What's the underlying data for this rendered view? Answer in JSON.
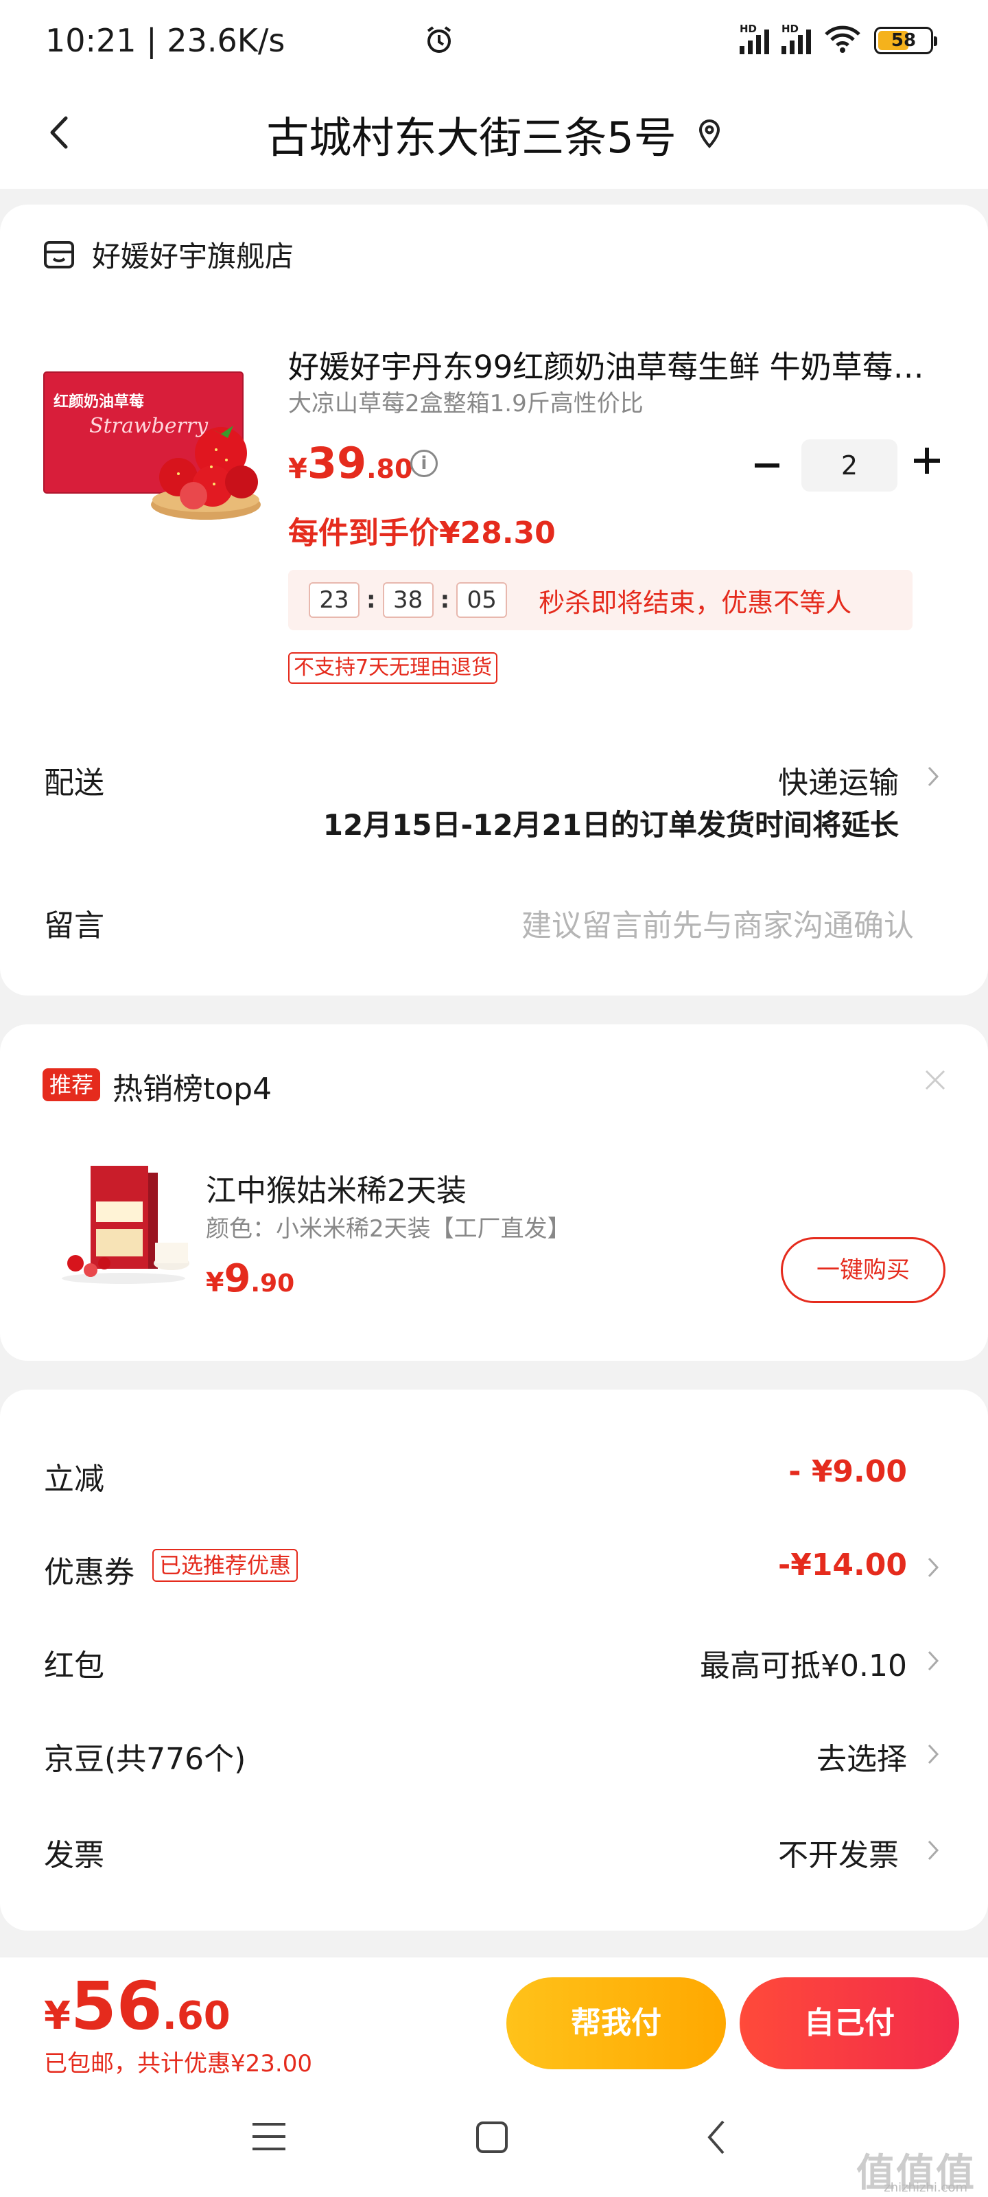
{
  "status_bar": {
    "time": "10:21 | 23.6K/s",
    "signal1": "HD",
    "signal2": "HD",
    "battery": "58"
  },
  "header": {
    "title": "古城村东大街三条5号"
  },
  "store": {
    "name": "好媛好宇旗舰店"
  },
  "product": {
    "name": "好媛好宇丹东99红颜奶油草莓生鲜 牛奶草莓…",
    "spec": "大凉山草莓2盒整箱1.9斤高性价比",
    "price_symbol": "¥",
    "price_int": "39",
    "price_dec": ".80",
    "quantity": "2",
    "final_price": "每件到手价¥28.30",
    "countdown": {
      "h": "23",
      "m": "38",
      "s": "05",
      "text": "秒杀即将结束，优惠不等人"
    },
    "return_tag": "不支持7天无理由退货",
    "image_title": "红颜奶油草莓",
    "image_subtitle": "Strawberry"
  },
  "delivery": {
    "label": "配送",
    "value": "快递运输",
    "note": "12月15日-12月21日的订单发货时间将延长"
  },
  "message": {
    "label": "留言",
    "placeholder": "建议留言前先与商家沟通确认"
  },
  "recommend": {
    "badge": "推荐",
    "title": "热销榜top4",
    "item": {
      "name": "江中猴姑米稀2天装",
      "spec": "颜色：小米米稀2天装【工厂直发】",
      "price_symbol": "¥",
      "price_int": "9",
      "price_dec": ".90",
      "button": "一键购买"
    }
  },
  "discounts": {
    "direct_label": "立减",
    "direct_value": "- ¥9.00",
    "coupon_label": "优惠券",
    "coupon_tag": "已选推荐优惠",
    "coupon_value": "-¥14.00",
    "redpacket_label": "红包",
    "redpacket_value": "最高可抵¥0.10",
    "jingdou_label": "京豆(共776个)",
    "jingdou_value": "去选择",
    "invoice_label": "发票",
    "invoice_value": "不开发票"
  },
  "bottom": {
    "total_symbol": "¥",
    "total_int": "56",
    "total_dec": ".60",
    "summary": "已包邮，共计优惠¥23.00",
    "help_pay": "帮我付",
    "self_pay": "自己付"
  },
  "watermark": {
    "text": "值值值",
    "sub": "zhizhizhi.com"
  },
  "colors": {
    "accent": "#e52b1d",
    "help_button": "#ffb300",
    "self_button": "#f53340"
  }
}
